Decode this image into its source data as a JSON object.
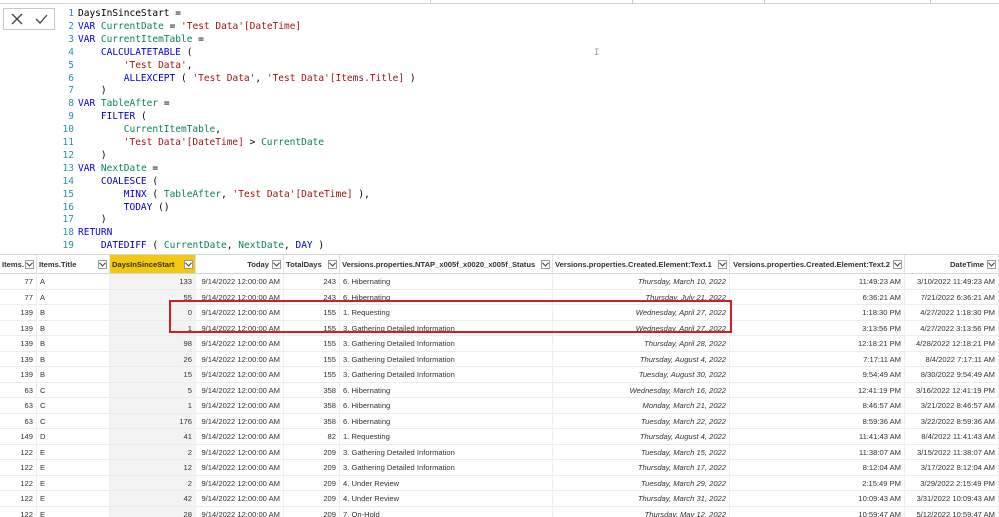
{
  "formula_bar": {
    "code_lines": [
      "DaysInSinceStart =",
      "VAR CurrentDate = 'Test Data'[DateTime]",
      "VAR CurrentItemTable =",
      "    CALCULATETABLE (",
      "        'Test Data',",
      "        ALLEXCEPT ( 'Test Data', 'Test Data'[Items.Title] )",
      "    )",
      "VAR TableAfter =",
      "    FILTER (",
      "        CurrentItemTable,",
      "        'Test Data'[DateTime] > CurrentDate",
      "    )",
      "VAR NextDate =",
      "    COALESCE (",
      "        MINX ( TableAfter, 'Test Data'[DateTime] ),",
      "        TODAY ()",
      "    )",
      "RETURN",
      "    DATEDIFF ( CurrentDate, NextDate, DAY )"
    ],
    "line_numbers": [
      "1",
      "2",
      "3",
      "4",
      "5",
      "6",
      "7",
      "8",
      "9",
      "10",
      "11",
      "12",
      "13",
      "14",
      "15",
      "16",
      "17",
      "18",
      "19"
    ],
    "cancel_icon": "close-icon",
    "commit_icon": "checkmark-icon",
    "cursor_glyph": "I"
  },
  "table": {
    "columns": [
      "Items.Id",
      "Items.Title",
      "DaysInSinceStart",
      "Today",
      "TotalDays",
      "Versions.properties.NTAP_x005f_x0020_x005f_Status",
      "Versions.properties.Created.Element:Text.1",
      "Versions.properties.Created.Element:Text.2",
      "DateTime"
    ],
    "rows": [
      [
        "77",
        "A",
        "133",
        "9/14/2022 12:00:00 AM",
        "243",
        "6. Hibernating",
        "Thursday, March 10, 2022",
        "11:49:23 AM",
        "3/10/2022 11:49:23 AM"
      ],
      [
        "77",
        "A",
        "55",
        "9/14/2022 12:00:00 AM",
        "243",
        "6. Hibernating",
        "Thursday, July 21, 2022",
        "6:36:21 AM",
        "7/21/2022 6:36:21 AM"
      ],
      [
        "139",
        "B",
        "0",
        "9/14/2022 12:00:00 AM",
        "155",
        "1. Requesting",
        "Wednesday, April 27, 2022",
        "1:18:30 PM",
        "4/27/2022 1:18:30 PM"
      ],
      [
        "139",
        "B",
        "1",
        "9/14/2022 12:00:00 AM",
        "155",
        "3. Gathering Detailed Information",
        "Wednesday, April 27, 2022",
        "3:13:56 PM",
        "4/27/2022 3:13:56 PM"
      ],
      [
        "139",
        "B",
        "98",
        "9/14/2022 12:00:00 AM",
        "155",
        "3. Gathering Detailed Information",
        "Thursday, April 28, 2022",
        "12:18:21 PM",
        "4/28/2022 12:18:21 PM"
      ],
      [
        "139",
        "B",
        "26",
        "9/14/2022 12:00:00 AM",
        "155",
        "3. Gathering Detailed Information",
        "Thursday, August 4, 2022",
        "7:17:11 AM",
        "8/4/2022 7:17:11 AM"
      ],
      [
        "139",
        "B",
        "15",
        "9/14/2022 12:00:00 AM",
        "155",
        "3. Gathering Detailed Information",
        "Tuesday, August 30, 2022",
        "9:54:49 AM",
        "8/30/2022 9:54:49 AM"
      ],
      [
        "63",
        "C",
        "5",
        "9/14/2022 12:00:00 AM",
        "358",
        "6. Hibernating",
        "Wednesday, March 16, 2022",
        "12:41:19 PM",
        "3/16/2022 12:41:19 PM"
      ],
      [
        "63",
        "C",
        "1",
        "9/14/2022 12:00:00 AM",
        "358",
        "6. Hibernating",
        "Monday, March 21, 2022",
        "8:46:57 AM",
        "3/21/2022 8:46:57 AM"
      ],
      [
        "63",
        "C",
        "176",
        "9/14/2022 12:00:00 AM",
        "358",
        "6. Hibernating",
        "Tuesday, March 22, 2022",
        "8:59:36 AM",
        "3/22/2022 8:59:36 AM"
      ],
      [
        "149",
        "D",
        "41",
        "9/14/2022 12:00:00 AM",
        "82",
        "1. Requesting",
        "Thursday, August 4, 2022",
        "11:41:43 AM",
        "8/4/2022 11:41:43 AM"
      ],
      [
        "122",
        "E",
        "2",
        "9/14/2022 12:00:00 AM",
        "209",
        "3. Gathering Detailed Information",
        "Tuesday, March 15, 2022",
        "11:38:07 AM",
        "3/15/2022 11:38:07 AM"
      ],
      [
        "122",
        "E",
        "12",
        "9/14/2022 12:00:00 AM",
        "209",
        "3. Gathering Detailed Information",
        "Thursday, March 17, 2022",
        "8:12:04 AM",
        "3/17/2022 8:12:04 AM"
      ],
      [
        "122",
        "E",
        "2",
        "9/14/2022 12:00:00 AM",
        "209",
        "4. Under Review",
        "Tuesday, March 29, 2022",
        "2:15:49 PM",
        "3/29/2022 2:15:49 PM"
      ],
      [
        "122",
        "E",
        "42",
        "9/14/2022 12:00:00 AM",
        "209",
        "4. Under Review",
        "Thursday, March 31, 2022",
        "10:09:43 AM",
        "3/31/2022 10:09:43 AM"
      ],
      [
        "122",
        "E",
        "28",
        "9/14/2022 12:00:00 AM",
        "209",
        "7. On-Hold",
        "Thursday, May 12, 2022",
        "10:59:47 AM",
        "5/12/2022 10:59:47 AM"
      ]
    ],
    "selected_column": "DaysInSinceStart",
    "colors": {
      "selected_header": "#f2c811",
      "highlight_box": "#d11f25"
    }
  }
}
